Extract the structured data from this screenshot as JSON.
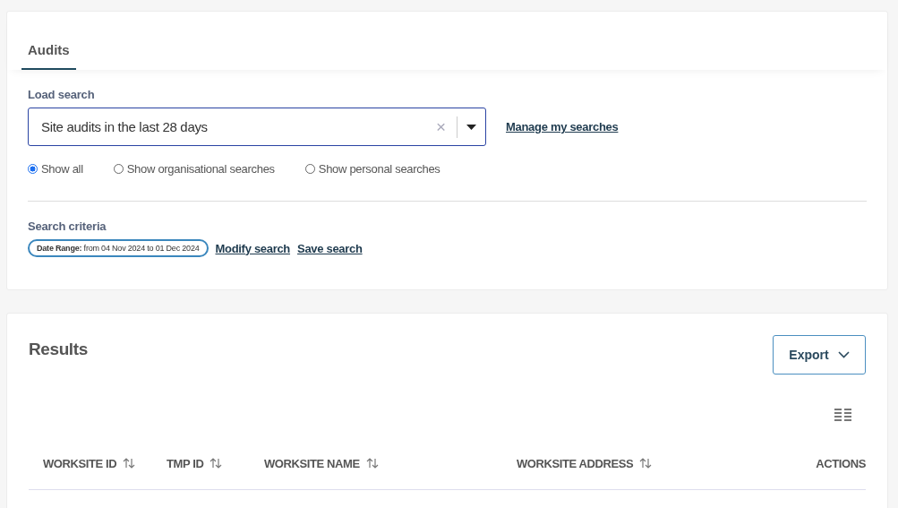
{
  "tabs": [
    {
      "label": "Audits",
      "selected": true
    }
  ],
  "load_search": {
    "label": "Load search",
    "value": "Site audits in the last 28 days",
    "clear": "×",
    "manage_link": "Manage my searches"
  },
  "filters": [
    {
      "label": "Show all",
      "selected": true
    },
    {
      "label": "Show organisational searches",
      "selected": false
    },
    {
      "label": "Show personal searches",
      "selected": false
    }
  ],
  "criteria": {
    "label": "Search criteria",
    "chip_key": "Date Range:",
    "chip_value": "from 04 Nov 2024 to 01 Dec 2024",
    "links": [
      "Modify search",
      "Save search"
    ]
  },
  "results": {
    "title": "Results",
    "export": "Export",
    "columns": [
      {
        "label": "WORKSITE ID",
        "sortable": true
      },
      {
        "label": "TMP ID",
        "sortable": true
      },
      {
        "label": "WORKSITE NAME",
        "sortable": true
      },
      {
        "label": "WORKSITE ADDRESS",
        "sortable": true
      },
      {
        "label": "ACTIONS",
        "sortable": false
      }
    ]
  }
}
